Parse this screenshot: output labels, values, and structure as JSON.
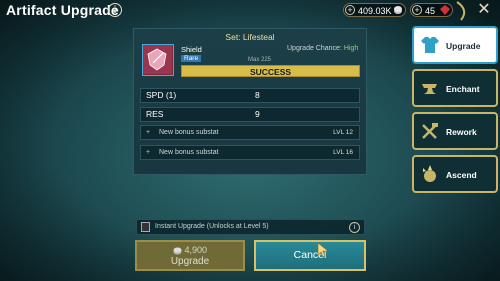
{
  "header": {
    "title": "Artifact Upgrade",
    "info_icon": "i",
    "silver": "409.03K",
    "gems": "45",
    "close_glyph": "✕"
  },
  "artifact": {
    "set_title": "Set: Lifesteal",
    "name": "Shield",
    "rarity": "Rare",
    "upgrade_chance_label": "Upgrade Chance:",
    "upgrade_chance_value": "High",
    "max_level": "Max 225",
    "result": "SUCCESS",
    "stats": [
      {
        "label": "SPD (1)",
        "value": "8"
      },
      {
        "label": "RES",
        "value": "9"
      }
    ],
    "substats": [
      {
        "label": "New bonus substat",
        "level": "LVL 12"
      },
      {
        "label": "New bonus substat",
        "level": "LVL 16"
      }
    ]
  },
  "instant": {
    "label": "Instant Upgrade (Unlocks at Level 5)",
    "info_icon": "i"
  },
  "actions": {
    "upgrade_cost": "4,900",
    "upgrade_label": "Upgrade",
    "cancel_label": "Cancel"
  },
  "tabs": [
    {
      "label": "Upgrade",
      "icon": "shirt-icon",
      "active": true
    },
    {
      "label": "Enchant",
      "icon": "anvil-icon",
      "active": false
    },
    {
      "label": "Rework",
      "icon": "hammer-wrench-icon",
      "active": false
    },
    {
      "label": "Ascend",
      "icon": "ascend-icon",
      "active": false
    }
  ],
  "colors": {
    "success": "#d8bd4a",
    "cancel": "#2a8a97",
    "high": "#7fe06a",
    "tab_border": "#c9b467"
  }
}
